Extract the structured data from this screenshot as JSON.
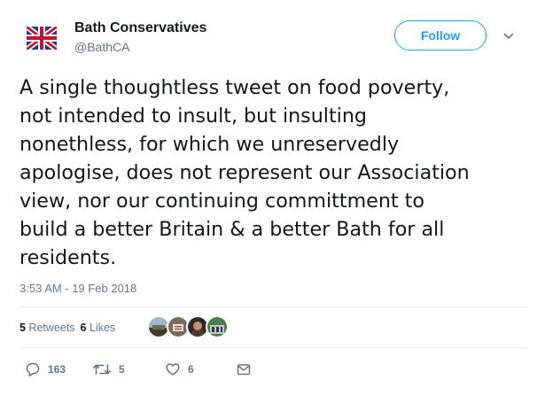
{
  "author": {
    "display_name": "Bath Conservatives",
    "handle": "@BathCA",
    "avatar_icon": "union-jack-tree-icon"
  },
  "follow_button": {
    "label": "Follow"
  },
  "tweet": {
    "text": "A single thoughtless tweet on food poverty,\nnot intended to insult, but insulting\nnonethless, for which we unreservedly\napologise, does not represent our Association\nview, nor our continuing committment to\nbuild a better Britain & a better Bath for all\nresidents.",
    "timestamp": "3:53 AM - 19 Feb 2018"
  },
  "stats": {
    "retweets_count": "5",
    "retweets_label": "Retweets",
    "likes_count": "6",
    "likes_label": "Likes"
  },
  "actions": {
    "reply_count": "163",
    "retweet_count": "5",
    "like_count": "6"
  },
  "colors": {
    "accent": "#1da1f2",
    "text": "#14171a",
    "muted": "#657786",
    "divider": "#e6ecf0"
  }
}
